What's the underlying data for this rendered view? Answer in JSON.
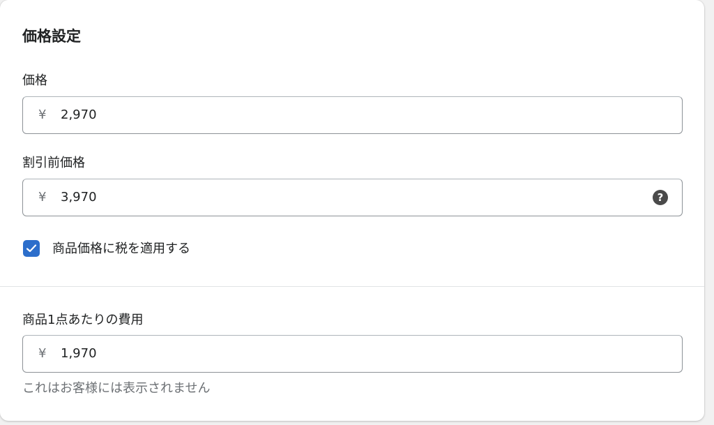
{
  "section": {
    "title": "価格設定"
  },
  "price": {
    "label": "価格",
    "currency_symbol": "¥",
    "value": "2,970"
  },
  "compare_at_price": {
    "label": "割引前価格",
    "currency_symbol": "¥",
    "value": "3,970",
    "help_icon": "question-circle-icon",
    "help_glyph": "?"
  },
  "tax": {
    "label": "商品価格に税を適用する",
    "checked": true,
    "accent_color": "#2c6ecb"
  },
  "cost_per_item": {
    "label": "商品1点あたりの費用",
    "currency_symbol": "¥",
    "value": "1,970",
    "help_text": "これはお客様には表示されません"
  }
}
